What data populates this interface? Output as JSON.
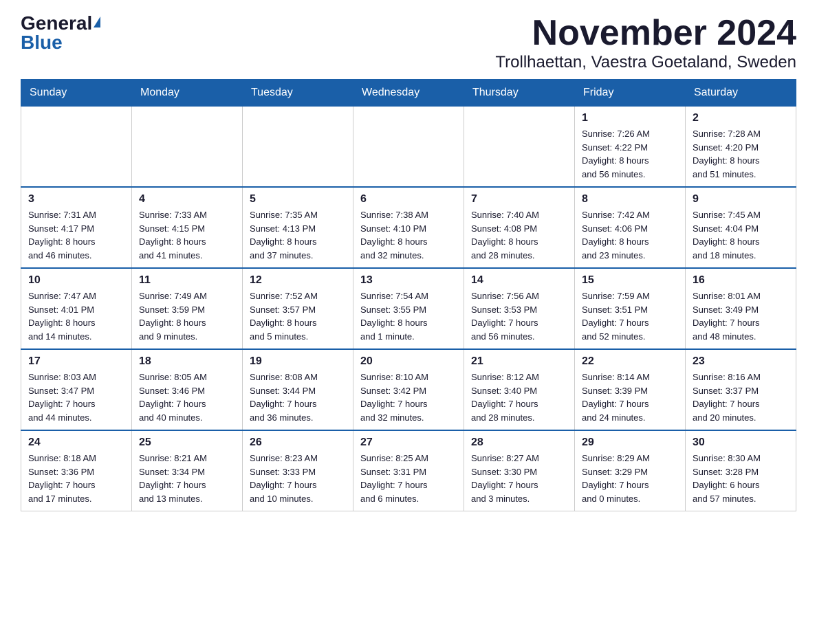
{
  "logo": {
    "general": "General",
    "blue": "Blue"
  },
  "title": "November 2024",
  "subtitle": "Trollhaettan, Vaestra Goetaland, Sweden",
  "days_of_week": [
    "Sunday",
    "Monday",
    "Tuesday",
    "Wednesday",
    "Thursday",
    "Friday",
    "Saturday"
  ],
  "weeks": [
    [
      {
        "day": "",
        "info": ""
      },
      {
        "day": "",
        "info": ""
      },
      {
        "day": "",
        "info": ""
      },
      {
        "day": "",
        "info": ""
      },
      {
        "day": "",
        "info": ""
      },
      {
        "day": "1",
        "info": "Sunrise: 7:26 AM\nSunset: 4:22 PM\nDaylight: 8 hours\nand 56 minutes."
      },
      {
        "day": "2",
        "info": "Sunrise: 7:28 AM\nSunset: 4:20 PM\nDaylight: 8 hours\nand 51 minutes."
      }
    ],
    [
      {
        "day": "3",
        "info": "Sunrise: 7:31 AM\nSunset: 4:17 PM\nDaylight: 8 hours\nand 46 minutes."
      },
      {
        "day": "4",
        "info": "Sunrise: 7:33 AM\nSunset: 4:15 PM\nDaylight: 8 hours\nand 41 minutes."
      },
      {
        "day": "5",
        "info": "Sunrise: 7:35 AM\nSunset: 4:13 PM\nDaylight: 8 hours\nand 37 minutes."
      },
      {
        "day": "6",
        "info": "Sunrise: 7:38 AM\nSunset: 4:10 PM\nDaylight: 8 hours\nand 32 minutes."
      },
      {
        "day": "7",
        "info": "Sunrise: 7:40 AM\nSunset: 4:08 PM\nDaylight: 8 hours\nand 28 minutes."
      },
      {
        "day": "8",
        "info": "Sunrise: 7:42 AM\nSunset: 4:06 PM\nDaylight: 8 hours\nand 23 minutes."
      },
      {
        "day": "9",
        "info": "Sunrise: 7:45 AM\nSunset: 4:04 PM\nDaylight: 8 hours\nand 18 minutes."
      }
    ],
    [
      {
        "day": "10",
        "info": "Sunrise: 7:47 AM\nSunset: 4:01 PM\nDaylight: 8 hours\nand 14 minutes."
      },
      {
        "day": "11",
        "info": "Sunrise: 7:49 AM\nSunset: 3:59 PM\nDaylight: 8 hours\nand 9 minutes."
      },
      {
        "day": "12",
        "info": "Sunrise: 7:52 AM\nSunset: 3:57 PM\nDaylight: 8 hours\nand 5 minutes."
      },
      {
        "day": "13",
        "info": "Sunrise: 7:54 AM\nSunset: 3:55 PM\nDaylight: 8 hours\nand 1 minute."
      },
      {
        "day": "14",
        "info": "Sunrise: 7:56 AM\nSunset: 3:53 PM\nDaylight: 7 hours\nand 56 minutes."
      },
      {
        "day": "15",
        "info": "Sunrise: 7:59 AM\nSunset: 3:51 PM\nDaylight: 7 hours\nand 52 minutes."
      },
      {
        "day": "16",
        "info": "Sunrise: 8:01 AM\nSunset: 3:49 PM\nDaylight: 7 hours\nand 48 minutes."
      }
    ],
    [
      {
        "day": "17",
        "info": "Sunrise: 8:03 AM\nSunset: 3:47 PM\nDaylight: 7 hours\nand 44 minutes."
      },
      {
        "day": "18",
        "info": "Sunrise: 8:05 AM\nSunset: 3:46 PM\nDaylight: 7 hours\nand 40 minutes."
      },
      {
        "day": "19",
        "info": "Sunrise: 8:08 AM\nSunset: 3:44 PM\nDaylight: 7 hours\nand 36 minutes."
      },
      {
        "day": "20",
        "info": "Sunrise: 8:10 AM\nSunset: 3:42 PM\nDaylight: 7 hours\nand 32 minutes."
      },
      {
        "day": "21",
        "info": "Sunrise: 8:12 AM\nSunset: 3:40 PM\nDaylight: 7 hours\nand 28 minutes."
      },
      {
        "day": "22",
        "info": "Sunrise: 8:14 AM\nSunset: 3:39 PM\nDaylight: 7 hours\nand 24 minutes."
      },
      {
        "day": "23",
        "info": "Sunrise: 8:16 AM\nSunset: 3:37 PM\nDaylight: 7 hours\nand 20 minutes."
      }
    ],
    [
      {
        "day": "24",
        "info": "Sunrise: 8:18 AM\nSunset: 3:36 PM\nDaylight: 7 hours\nand 17 minutes."
      },
      {
        "day": "25",
        "info": "Sunrise: 8:21 AM\nSunset: 3:34 PM\nDaylight: 7 hours\nand 13 minutes."
      },
      {
        "day": "26",
        "info": "Sunrise: 8:23 AM\nSunset: 3:33 PM\nDaylight: 7 hours\nand 10 minutes."
      },
      {
        "day": "27",
        "info": "Sunrise: 8:25 AM\nSunset: 3:31 PM\nDaylight: 7 hours\nand 6 minutes."
      },
      {
        "day": "28",
        "info": "Sunrise: 8:27 AM\nSunset: 3:30 PM\nDaylight: 7 hours\nand 3 minutes."
      },
      {
        "day": "29",
        "info": "Sunrise: 8:29 AM\nSunset: 3:29 PM\nDaylight: 7 hours\nand 0 minutes."
      },
      {
        "day": "30",
        "info": "Sunrise: 8:30 AM\nSunset: 3:28 PM\nDaylight: 6 hours\nand 57 minutes."
      }
    ]
  ]
}
